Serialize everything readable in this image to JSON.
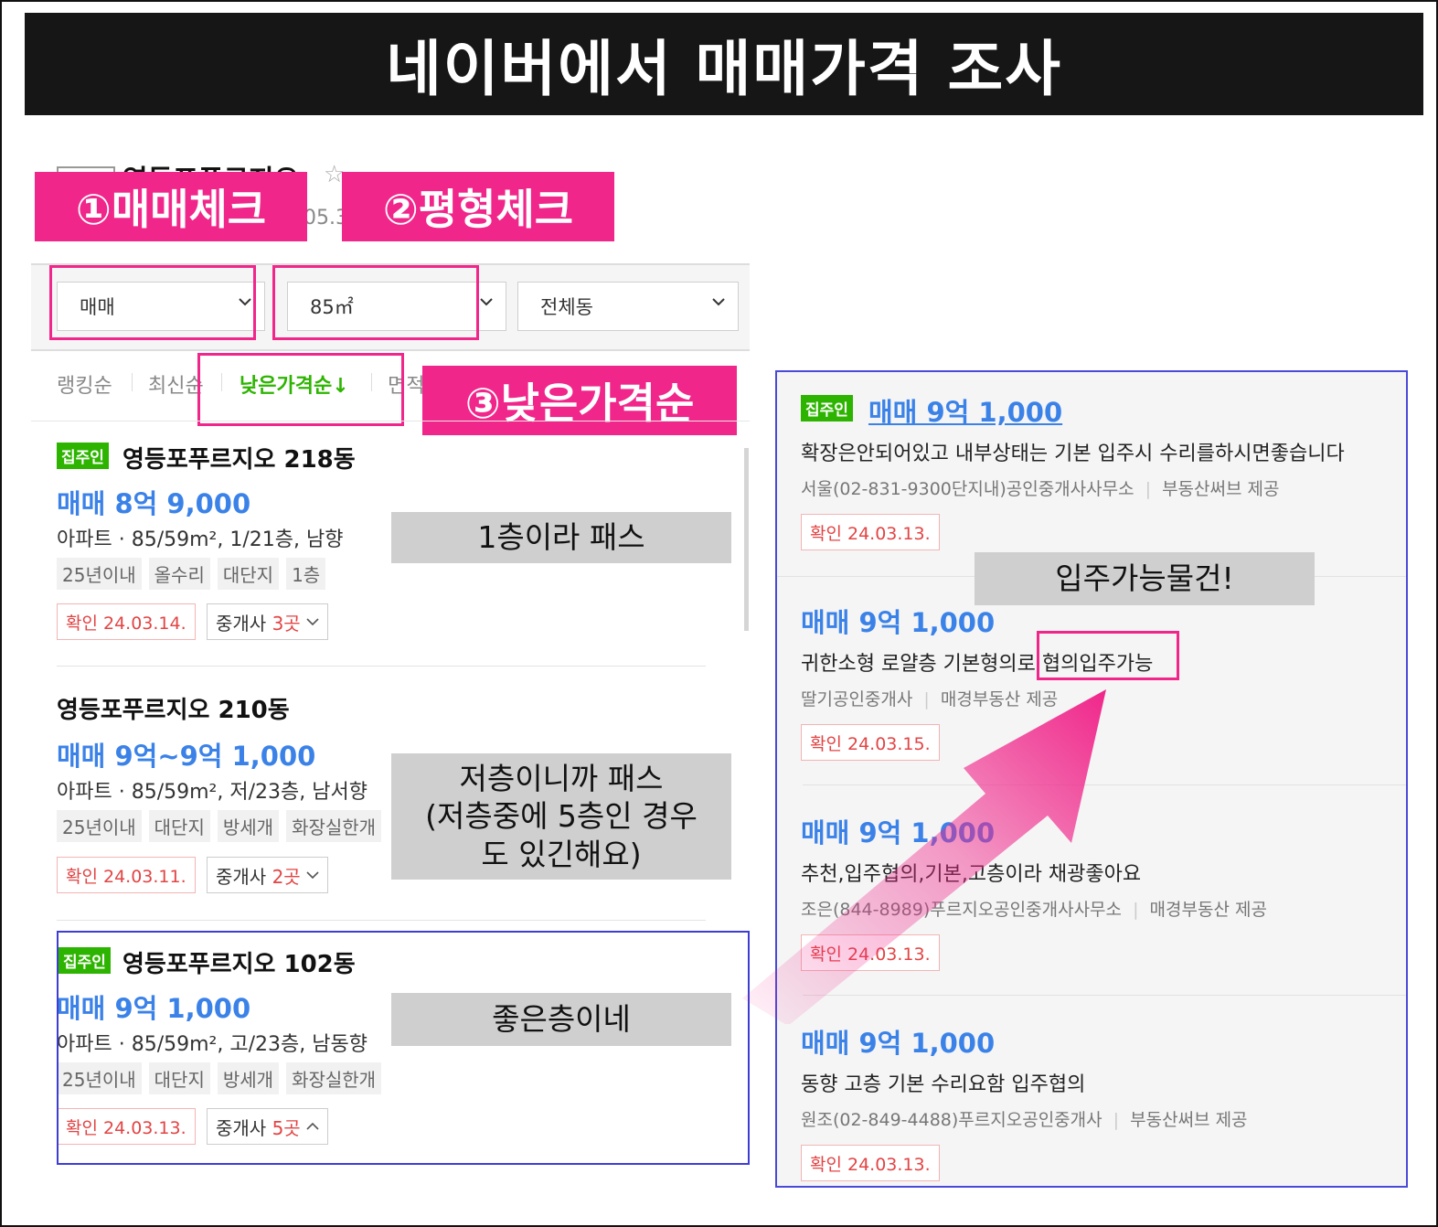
{
  "title": "네이버에서 매매가격 조사",
  "steps": {
    "step1": "①매매체크",
    "step2": "②평형체크",
    "step3": "③낮은가격순"
  },
  "header_partial": {
    "complex_name": "영등포푸르지오",
    "sub": "05.3"
  },
  "filters": {
    "trade_type": "매매",
    "area": "85㎡",
    "dong": "전체동"
  },
  "sort": {
    "ranking": "랭킹순",
    "latest": "최신순",
    "low_price": "낮은가격순↓",
    "area": "면적"
  },
  "listings": [
    {
      "badge": "집주인",
      "title": "영등포푸르지오 218동",
      "price": "매매 8억 9,000",
      "spec": "아파트 · 85/59m², 1/21층, 남향",
      "tags": [
        "25년이내",
        "올수리",
        "대단지",
        "1층"
      ],
      "confirm": "확인 24.03.14.",
      "agent_label": "중개사",
      "agent_count": "3곳",
      "note": "1층이라 패스"
    },
    {
      "badge": "",
      "title": "영등포푸르지오 210동",
      "price": "매매 9억~9억 1,000",
      "spec": "아파트 · 85/59m², 저/23층, 남서향",
      "tags": [
        "25년이내",
        "대단지",
        "방세개",
        "화장실한개"
      ],
      "confirm": "확인 24.03.11.",
      "agent_label": "중개사",
      "agent_count": "2곳",
      "note": "저층이니까 패스\n(저층중에 5층인 경우\n도 있긴해요)"
    },
    {
      "badge": "집주인",
      "title": "영등포푸르지오 102동",
      "price": "매매 9억 1,000",
      "spec": "아파트 · 85/59m², 고/23층, 남동향",
      "tags": [
        "25년이내",
        "대단지",
        "방세개",
        "화장실한개"
      ],
      "confirm": "확인 24.03.13.",
      "agent_label": "중개사",
      "agent_count": "5곳",
      "note": "좋은층이네"
    }
  ],
  "right_panel": {
    "items": [
      {
        "badge": "집주인",
        "price": "매매 9억 1,000",
        "desc": "확장은안되어있고 내부상태는 기본 입주시 수리를하시면좋습니다",
        "agent": "서울(02-831-9300단지내)공인중개사사무소",
        "provider": "부동산써브 제공",
        "confirm": "확인 24.03.13."
      },
      {
        "badge": "",
        "price": "매매 9억 1,000",
        "desc_pre": "귀한소형 로얄층 기본형의로 ",
        "desc_highlight": "협의입주가능",
        "agent": "딸기공인중개사",
        "provider": "매경부동산 제공",
        "confirm": "확인 24.03.15."
      },
      {
        "badge": "",
        "price": "매매 9억 1,000",
        "desc": "추천,입주협의,기본,고층이라 채광좋아요",
        "agent": "조은(844-8989)푸르지오공인중개사사무소",
        "provider": "매경부동산 제공",
        "confirm": "확인 24.03.13."
      },
      {
        "badge": "",
        "price": "매매 9억 1,000",
        "desc": "동향 고층 기본 수리요함 입주협의",
        "agent": "원조(02-849-4488)푸르지오공인중개사",
        "provider": "부동산써브 제공",
        "confirm": "확인 24.03.13."
      }
    ],
    "note": "입주가능물건!"
  },
  "colors": {
    "accent_pink": "#f0268a",
    "price_blue": "#3b82e8",
    "owner_badge_green": "#2db400",
    "sort_active_green": "#2db400",
    "confirm_red": "#e34444"
  }
}
